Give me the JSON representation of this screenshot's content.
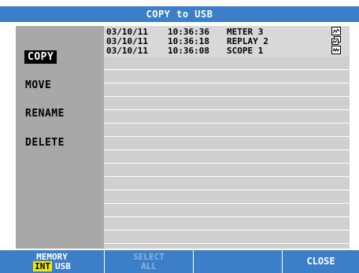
{
  "title": "COPY to USB",
  "menu": {
    "items": [
      {
        "label": "COPY",
        "selected": true
      },
      {
        "label": "MOVE",
        "selected": false
      },
      {
        "label": "RENAME",
        "selected": false
      },
      {
        "label": "DELETE",
        "selected": false
      }
    ]
  },
  "files": [
    {
      "date": "03/10/11",
      "time": "10:36:36",
      "name": "METER 3",
      "icon": "meter-file-icon"
    },
    {
      "date": "03/10/11",
      "time": "10:36:18",
      "name": "REPLAY 2",
      "icon": "replay-file-icon"
    },
    {
      "date": "03/10/11",
      "time": "10:36:08",
      "name": "SCOPE 1",
      "icon": "scope-file-icon"
    }
  ],
  "softkeys": {
    "memory": {
      "label": "MEMORY",
      "int_label": "INT",
      "usb_label": "USB"
    },
    "select_all": {
      "line1": "SELECT",
      "line2": "ALL",
      "enabled": false
    },
    "close": {
      "label": "CLOSE"
    }
  },
  "colors": {
    "accent": "#3d7ec8",
    "highlight": "#f2e600",
    "sidebar": "#a8a8a8",
    "list": "#cfcfcf"
  }
}
